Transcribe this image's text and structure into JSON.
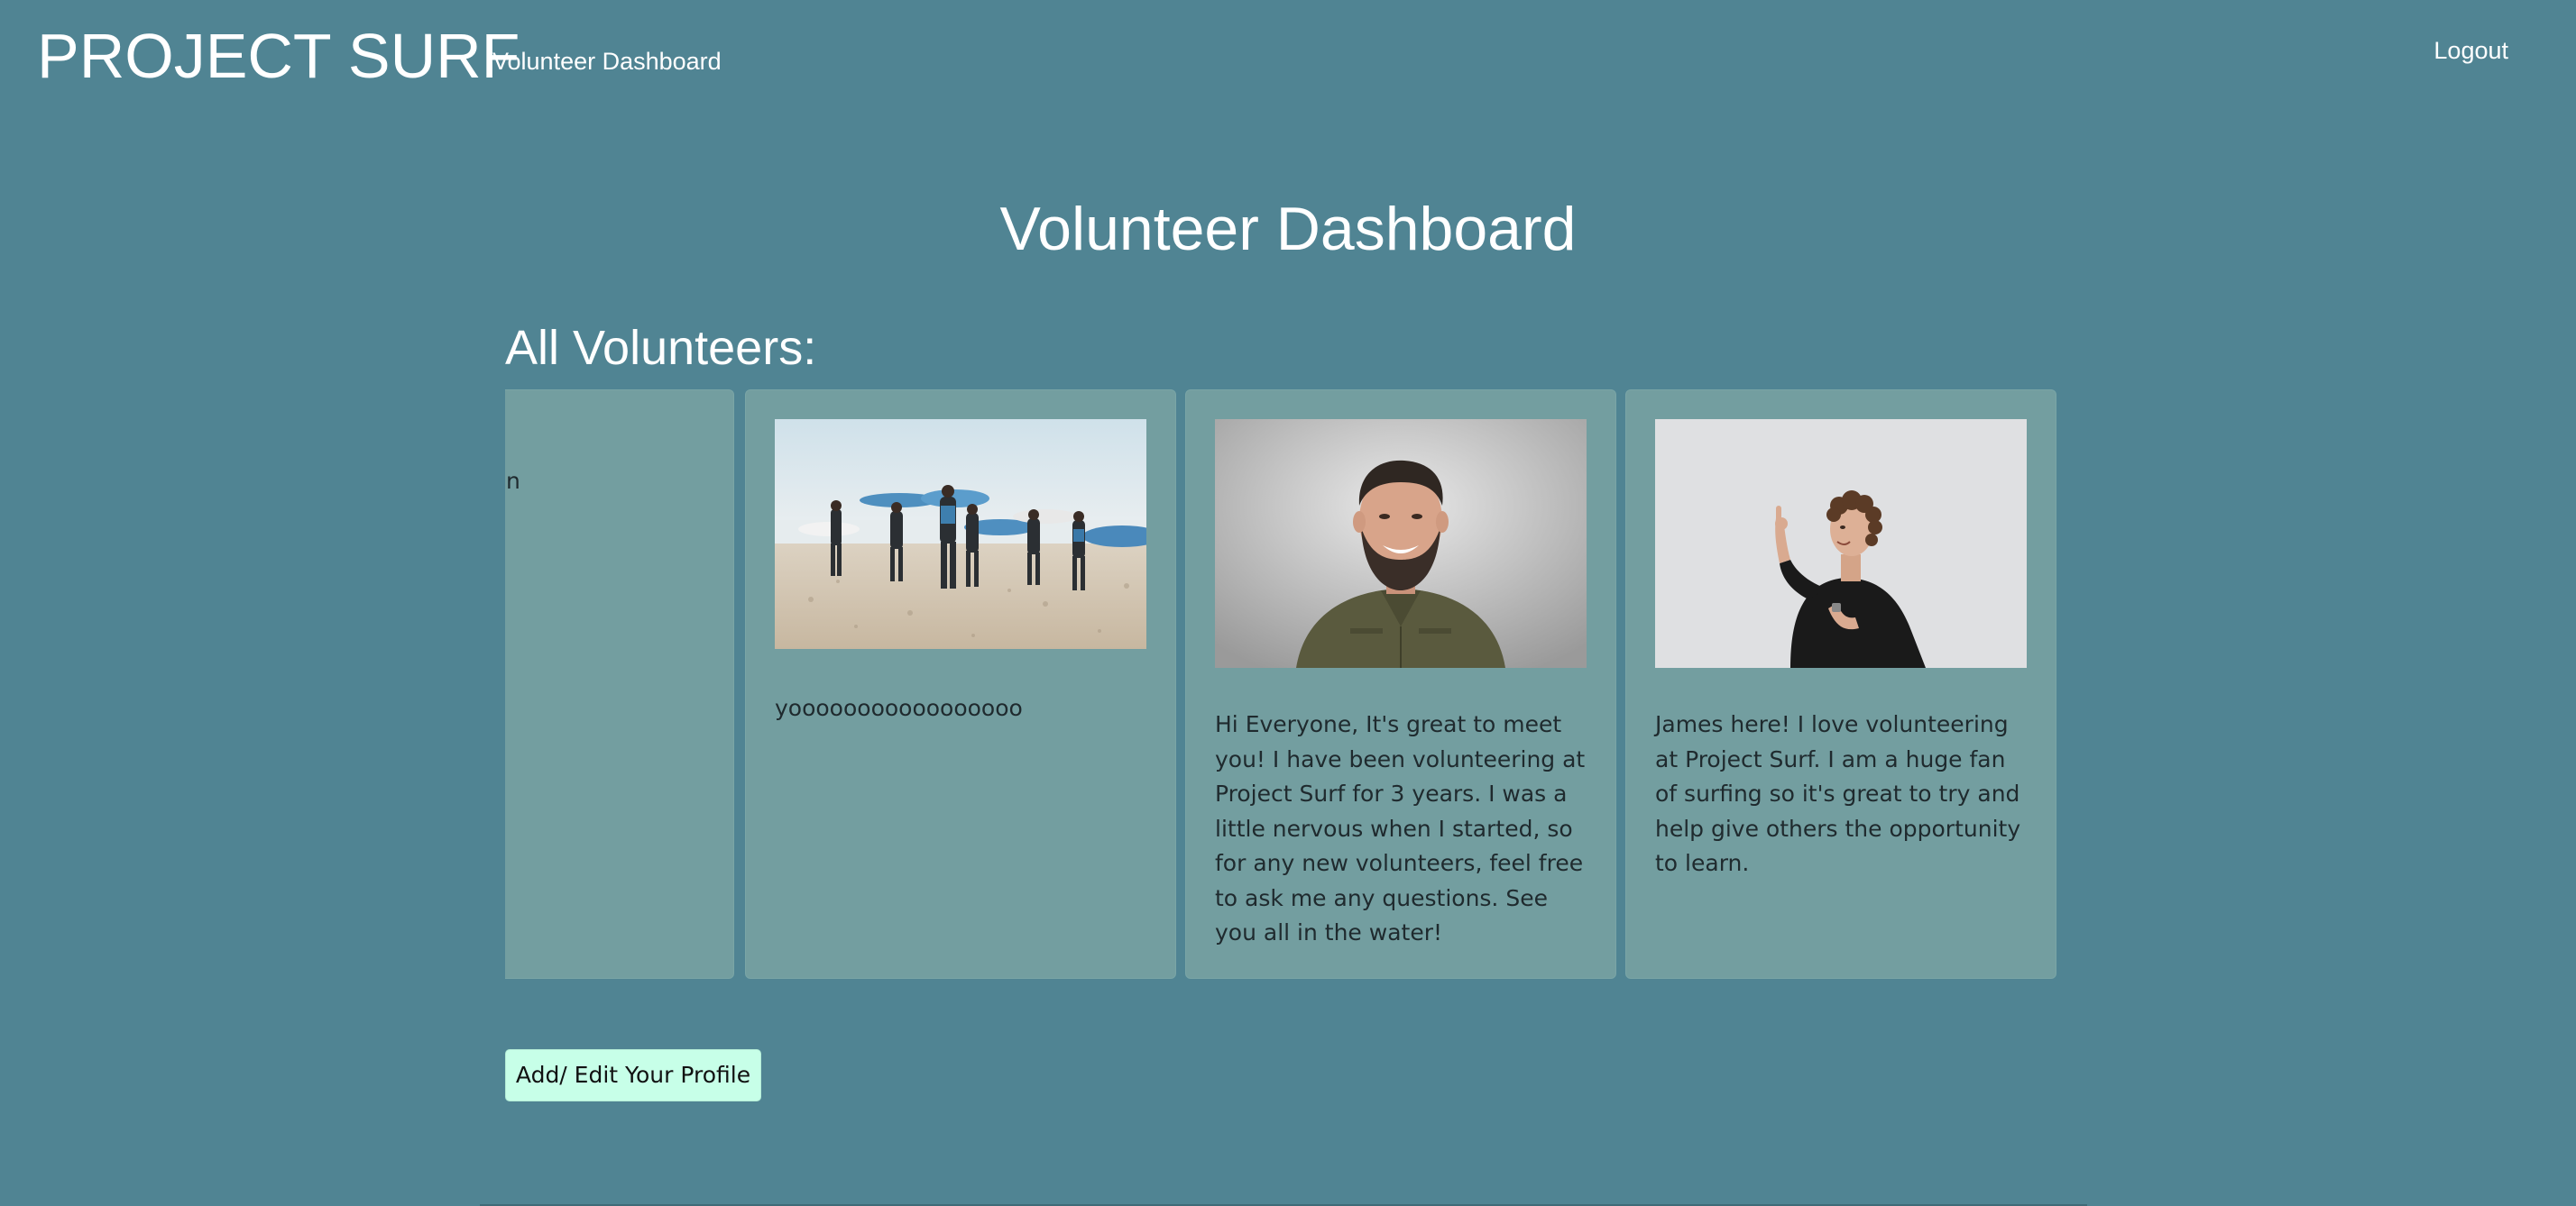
{
  "navbar": {
    "brand": "PROJECT SURF",
    "link": "Volunteer Dashboard",
    "logout": "Logout"
  },
  "page": {
    "title": "Volunteer Dashboard",
    "section_heading": "All Volunteers:"
  },
  "cards": {
    "partial_text": "n",
    "card1_text": "yooooooooooooooooo",
    "card2_text": "Hi Everyone, It's great to meet you! I have been volunteering at Project Surf for 3 years. I was a little nervous when I started, so for any new volunteers, feel free to ask me any questions. See you all in the water!",
    "card3_text": "James here! I love volunteering at Project Surf. I am a huge fan of surfing so it's great to try and help give others the opportunity to learn."
  },
  "actions": {
    "add_edit": "Add/ Edit Your Profile"
  },
  "colors": {
    "background": "#508493",
    "card": "#739ea0",
    "button": "#c7ffe8"
  }
}
